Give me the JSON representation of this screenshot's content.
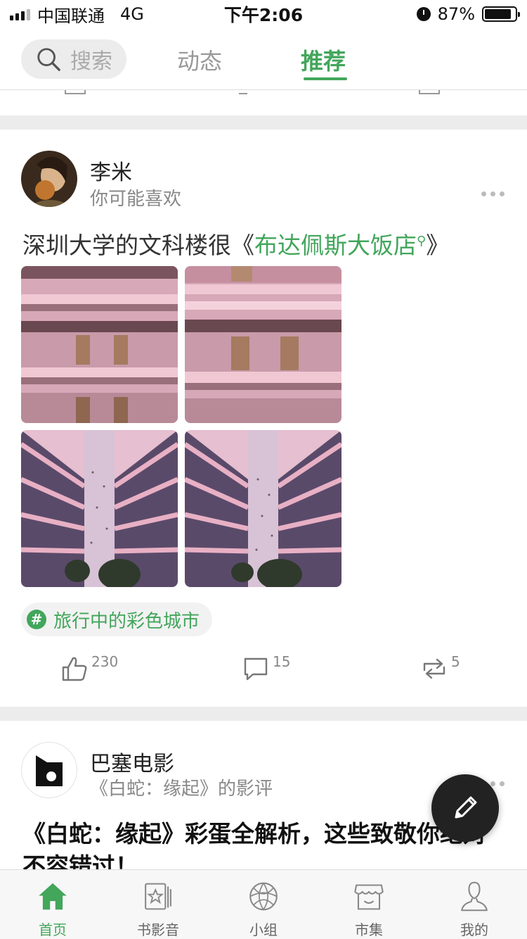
{
  "status_bar": {
    "carrier": "中国联通",
    "network": "4G",
    "time": "下午2:06",
    "battery": "87%",
    "battery_level": 0.87
  },
  "top_nav": {
    "search_placeholder": "搜索",
    "tabs": [
      {
        "label": "动态",
        "active": false
      },
      {
        "label": "推荐",
        "active": true
      }
    ]
  },
  "posts": [
    {
      "author": "李米",
      "subtitle": "你可能喜欢",
      "text_prefix": "深圳大学的文科楼很《",
      "text_link": "布达佩斯大饭店",
      "text_suffix": "》",
      "topic": "旅行中的彩色城市",
      "likes": "230",
      "comments": "15",
      "reposts": "5"
    },
    {
      "author": "巴塞电影",
      "subtitle": "《白蛇：缘起》的影评",
      "title": "《白蛇：缘起》彩蛋全解析，这些致敬你绝对不容错过！"
    }
  ],
  "tab_bar": [
    {
      "label": "首页",
      "icon": "home-icon",
      "active": true
    },
    {
      "label": "书影音",
      "icon": "media-icon",
      "active": false
    },
    {
      "label": "小组",
      "icon": "group-icon",
      "active": false
    },
    {
      "label": "市集",
      "icon": "market-icon",
      "active": false
    },
    {
      "label": "我的",
      "icon": "profile-icon",
      "active": false
    }
  ],
  "colors": {
    "accent": "#42a65b",
    "separator": "#ececec"
  }
}
